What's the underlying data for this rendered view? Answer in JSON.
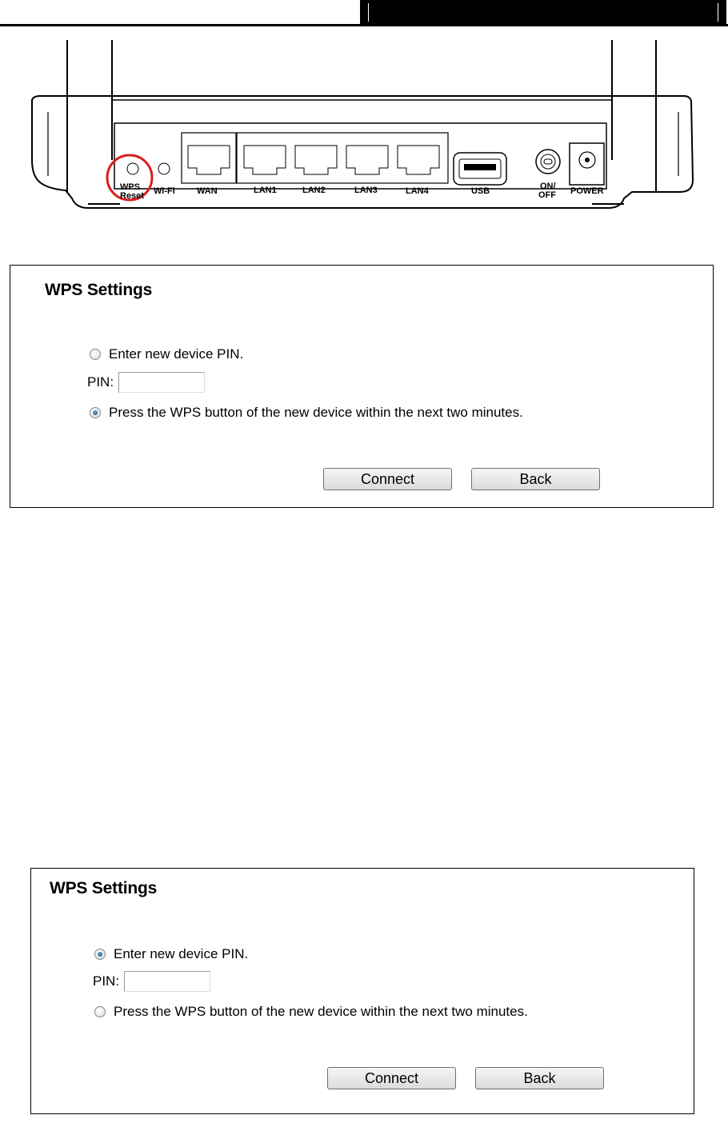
{
  "router": {
    "ports": {
      "wps_reset_line1": "WPS",
      "wps_reset_line2": "Reset",
      "wifi": "Wi-Fi",
      "wan": "WAN",
      "lan1": "LAN1",
      "lan2": "LAN2",
      "lan3": "LAN3",
      "lan4": "LAN4",
      "usb": "USB",
      "onoff_line1": "ON/",
      "onoff_line2": "OFF",
      "power": "POWER"
    },
    "highlight_color": "#d81e1e"
  },
  "panels": [
    {
      "title": "WPS Settings",
      "option1": "Enter new device PIN.",
      "pin_label": "PIN:",
      "pin_value": "",
      "option2": "Press the WPS button of the new device within the next two minutes.",
      "selected": 2,
      "connect_label": "Connect",
      "back_label": "Back"
    },
    {
      "title": "WPS Settings",
      "option1": "Enter new device PIN.",
      "pin_label": "PIN:",
      "pin_value": "",
      "option2": "Press the WPS button of the new device within the next two minutes.",
      "selected": 1,
      "connect_label": "Connect",
      "back_label": "Back"
    }
  ]
}
